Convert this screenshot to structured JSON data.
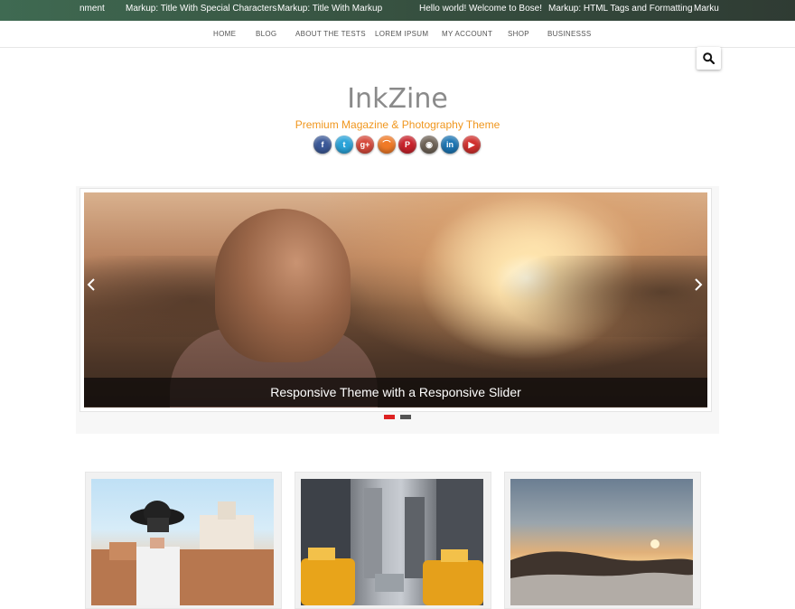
{
  "ticker": {
    "items": [
      "nment",
      "Markup: Title With Special Characters",
      "Markup: Title With Markup",
      "Hello world! Welcome to Bose!",
      "Markup: HTML Tags and Formatting",
      "Marku"
    ]
  },
  "nav": {
    "items": [
      "HOME",
      "BLOG",
      "ABOUT THE TESTS",
      "LOREM IPSUM",
      "MY ACCOUNT",
      "SHOP",
      "BUSINESSS"
    ]
  },
  "search": {
    "icon": "search-icon"
  },
  "site": {
    "title": "InkZine",
    "tagline": "Premium Magazine & Photography Theme"
  },
  "social": [
    {
      "icon": "facebook-icon",
      "glyph": "f",
      "color": "#3b5998"
    },
    {
      "icon": "twitter-icon",
      "glyph": "t",
      "color": "#2aa3d9"
    },
    {
      "icon": "google-plus-icon",
      "glyph": "g+",
      "color": "#d6493b"
    },
    {
      "icon": "rss-icon",
      "glyph": "⌒",
      "color": "#f07a27"
    },
    {
      "icon": "pinterest-icon",
      "glyph": "P",
      "color": "#c9222b"
    },
    {
      "icon": "instagram-icon",
      "glyph": "◉",
      "color": "#6e6256"
    },
    {
      "icon": "linkedin-icon",
      "glyph": "in",
      "color": "#1c75b3"
    },
    {
      "icon": "youtube-icon",
      "glyph": "▶",
      "color": "#d1302d"
    }
  ],
  "slider": {
    "caption": "Responsive Theme with a Responsive Slider",
    "active_index": 0,
    "slide_count": 2,
    "prev_icon": "chevron-left-icon",
    "next_icon": "chevron-right-icon",
    "colors": {
      "active_dot": "#dd2222",
      "inactive_dot": "#555555"
    }
  },
  "cards": [
    {
      "image": "photographer-with-camera"
    },
    {
      "image": "city-street-taxis"
    },
    {
      "image": "sunrise-over-clouds"
    }
  ]
}
